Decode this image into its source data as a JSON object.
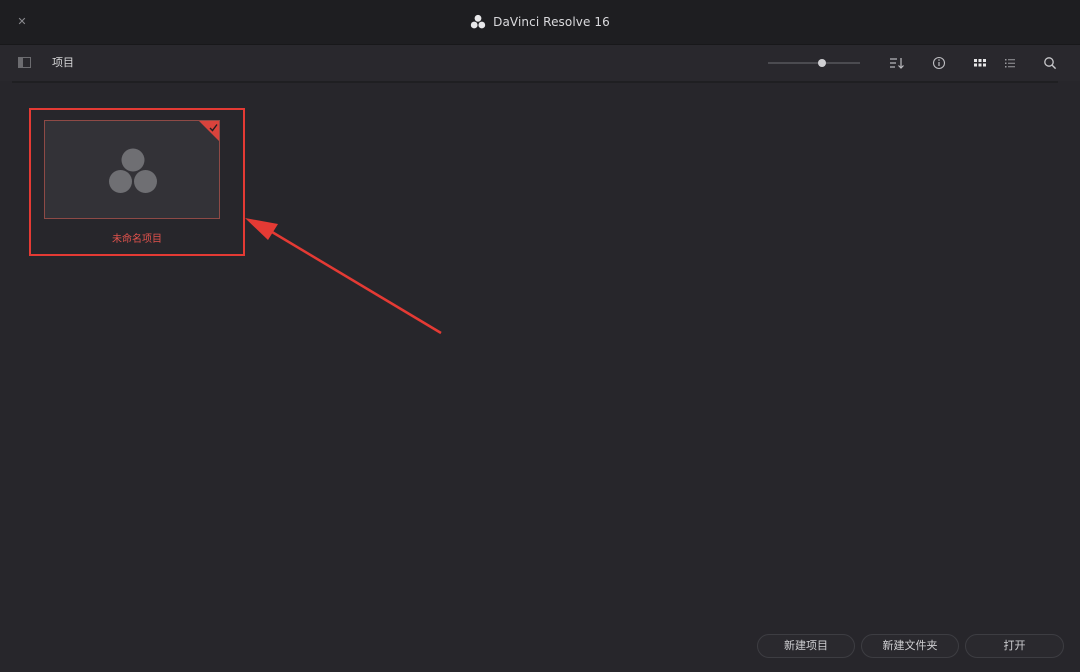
{
  "window": {
    "title": "DaVinci Resolve 16",
    "close_label": "✕"
  },
  "toolbar": {
    "section_title": "项目",
    "zoom_level": 0.6,
    "icons": [
      "sidebar-toggle-icon",
      "sort-icon",
      "info-icon",
      "grid-view-icon",
      "list-view-icon",
      "search-icon"
    ]
  },
  "projects": [
    {
      "name": "未命名项目",
      "selected": true
    }
  ],
  "footer": {
    "new_project_label": "新建项目",
    "new_folder_label": "新建文件夹",
    "open_label": "打开"
  },
  "colors": {
    "background": "#27262b",
    "titlebar": "#1e1e21",
    "highlight": "#e43a34",
    "logo": "#6f6f73"
  }
}
